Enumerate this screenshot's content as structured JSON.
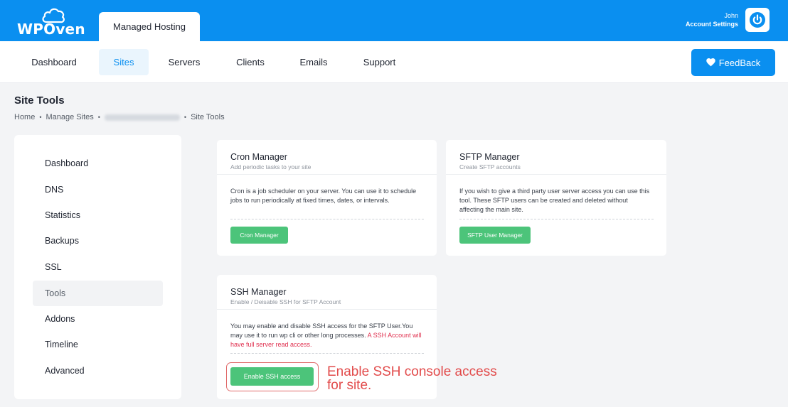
{
  "brand": {
    "name": "WPOven"
  },
  "header": {
    "active_tab": "Managed Hosting",
    "user_name": "John",
    "account_link": "Account Settings"
  },
  "nav": {
    "items": [
      {
        "label": "Dashboard"
      },
      {
        "label": "Sites",
        "active": true
      },
      {
        "label": "Servers"
      },
      {
        "label": "Clients"
      },
      {
        "label": "Emails"
      },
      {
        "label": "Support"
      }
    ],
    "feedback_label": "FeedBack"
  },
  "page": {
    "title": "Site Tools",
    "breadcrumb": [
      "Home",
      "Manage Sites",
      "Site Tools"
    ]
  },
  "sidebar": {
    "items": [
      {
        "label": "Dashboard"
      },
      {
        "label": "DNS"
      },
      {
        "label": "Statistics"
      },
      {
        "label": "Backups"
      },
      {
        "label": "SSL"
      },
      {
        "label": "Tools",
        "active": true
      },
      {
        "label": "Addons"
      },
      {
        "label": "Timeline"
      },
      {
        "label": "Advanced"
      }
    ]
  },
  "cards": {
    "cron": {
      "title": "Cron Manager",
      "subtitle": "Add periodic tasks to your site",
      "body": "Cron is a job scheduler on your server. You can use it to schedule jobs to run periodically at fixed times, dates, or intervals.",
      "button": "Cron Manager"
    },
    "sftp": {
      "title": "SFTP Manager",
      "subtitle": "Create SFTP accounts",
      "body": "If you wish to give a third party user server access you can use this tool. These SFTP users can be created and deleted without affecting the main site.",
      "button": "SFTP User Manager"
    },
    "ssh": {
      "title": "SSH Manager",
      "subtitle": "Enable / Deisable SSH for SFTP Account",
      "body": "You may enable and disable SSH access for the SFTP User.You may use it to run wp cli or other long processes.",
      "warning": "A SSH Account will have full server read access.",
      "button": "Enable SSH access"
    }
  },
  "annotation": {
    "text": "Enable SSH console access for site."
  },
  "colors": {
    "brand_blue": "#0a8ff0",
    "button_green": "#4cc47a",
    "warning_red": "#e0304f",
    "annotation_red": "#e24b4b"
  }
}
